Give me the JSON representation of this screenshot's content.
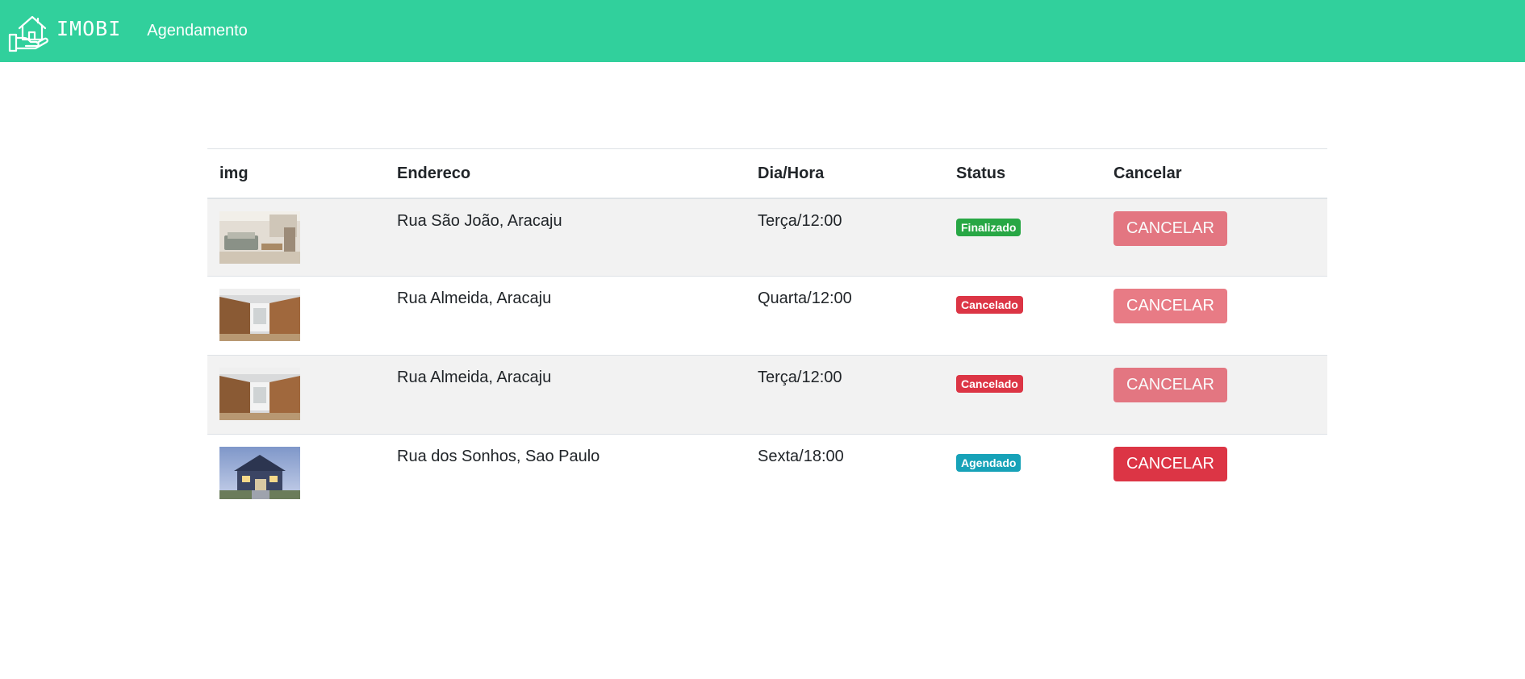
{
  "header": {
    "brand": "IMOBI",
    "nav_link": "Agendamento",
    "background_color": "#31d09c"
  },
  "table": {
    "columns": [
      "img",
      "Endereco",
      "Dia/Hora",
      "Status",
      "Cancelar"
    ],
    "rows": [
      {
        "image": "living-room-photo",
        "address": "Rua São João, Aracaju",
        "datetime": "Terça/12:00",
        "status": "Finalizado",
        "status_color": "#28a745",
        "button": "CANCELAR",
        "button_disabled": true
      },
      {
        "image": "kitchen-photo",
        "address": "Rua Almeida, Aracaju",
        "datetime": "Quarta/12:00",
        "status": "Cancelado",
        "status_color": "#dc3545",
        "button": "CANCELAR",
        "button_disabled": true
      },
      {
        "image": "kitchen-photo",
        "address": "Rua Almeida, Aracaju",
        "datetime": "Terça/12:00",
        "status": "Cancelado",
        "status_color": "#dc3545",
        "button": "CANCELAR",
        "button_disabled": true
      },
      {
        "image": "house-exterior-photo",
        "address": "Rua dos Sonhos, Sao Paulo",
        "datetime": "Sexta/18:00",
        "status": "Agendado",
        "status_color": "#17a2b8",
        "button": "CANCELAR",
        "button_disabled": false
      }
    ]
  }
}
